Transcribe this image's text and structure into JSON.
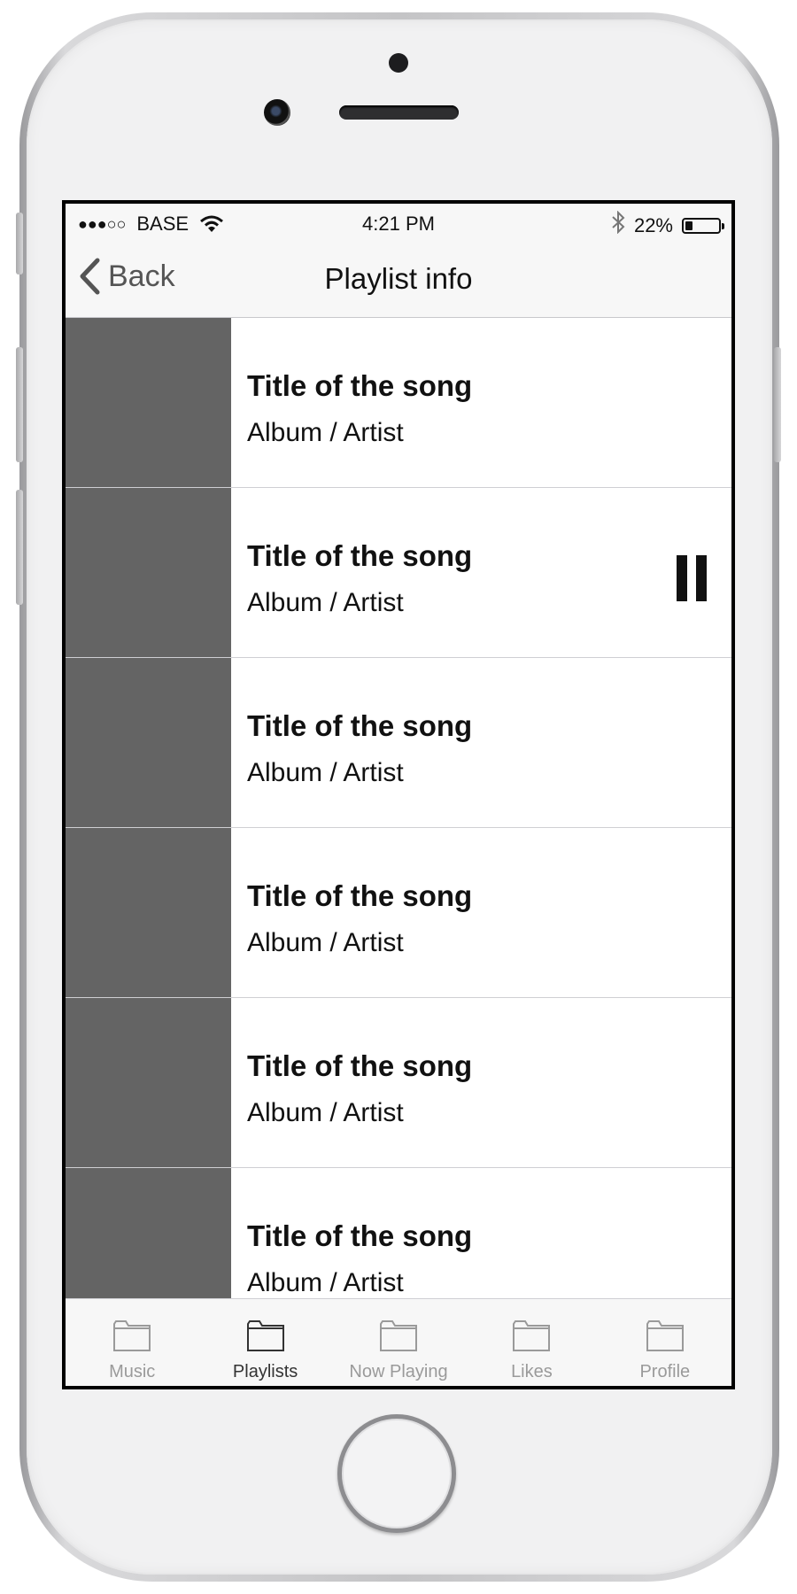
{
  "status_bar": {
    "signal": "●●●○○",
    "carrier": "BASE",
    "time": "4:21 PM",
    "battery_percent": "22%",
    "battery_level": 0.22
  },
  "nav": {
    "back_label": "Back",
    "title": "Playlist info"
  },
  "songs": [
    {
      "title": "Title of the song",
      "subtitle": "Album / Artist"
    },
    {
      "title": "Title of the song",
      "subtitle": "Album / Artist",
      "playing": true
    },
    {
      "title": "Title of the song",
      "subtitle": "Album / Artist"
    },
    {
      "title": "Title of the song",
      "subtitle": "Album / Artist"
    },
    {
      "title": "Title of the song",
      "subtitle": "Album / Artist"
    },
    {
      "title": "Title of the song",
      "subtitle": "Album / Artist"
    }
  ],
  "tabs": [
    {
      "label": "Music",
      "icon": "folder-icon"
    },
    {
      "label": "Playlists",
      "icon": "folder-icon",
      "active": true
    },
    {
      "label": "Now Playing",
      "icon": "folder-icon"
    },
    {
      "label": "Likes",
      "icon": "folder-icon"
    },
    {
      "label": "Profile",
      "icon": "folder-icon"
    }
  ],
  "colors": {
    "artwork_placeholder": "#646464",
    "bar_background": "#f7f7f7",
    "tab_inactive": "#9a9a9a",
    "tab_active": "#333333"
  }
}
